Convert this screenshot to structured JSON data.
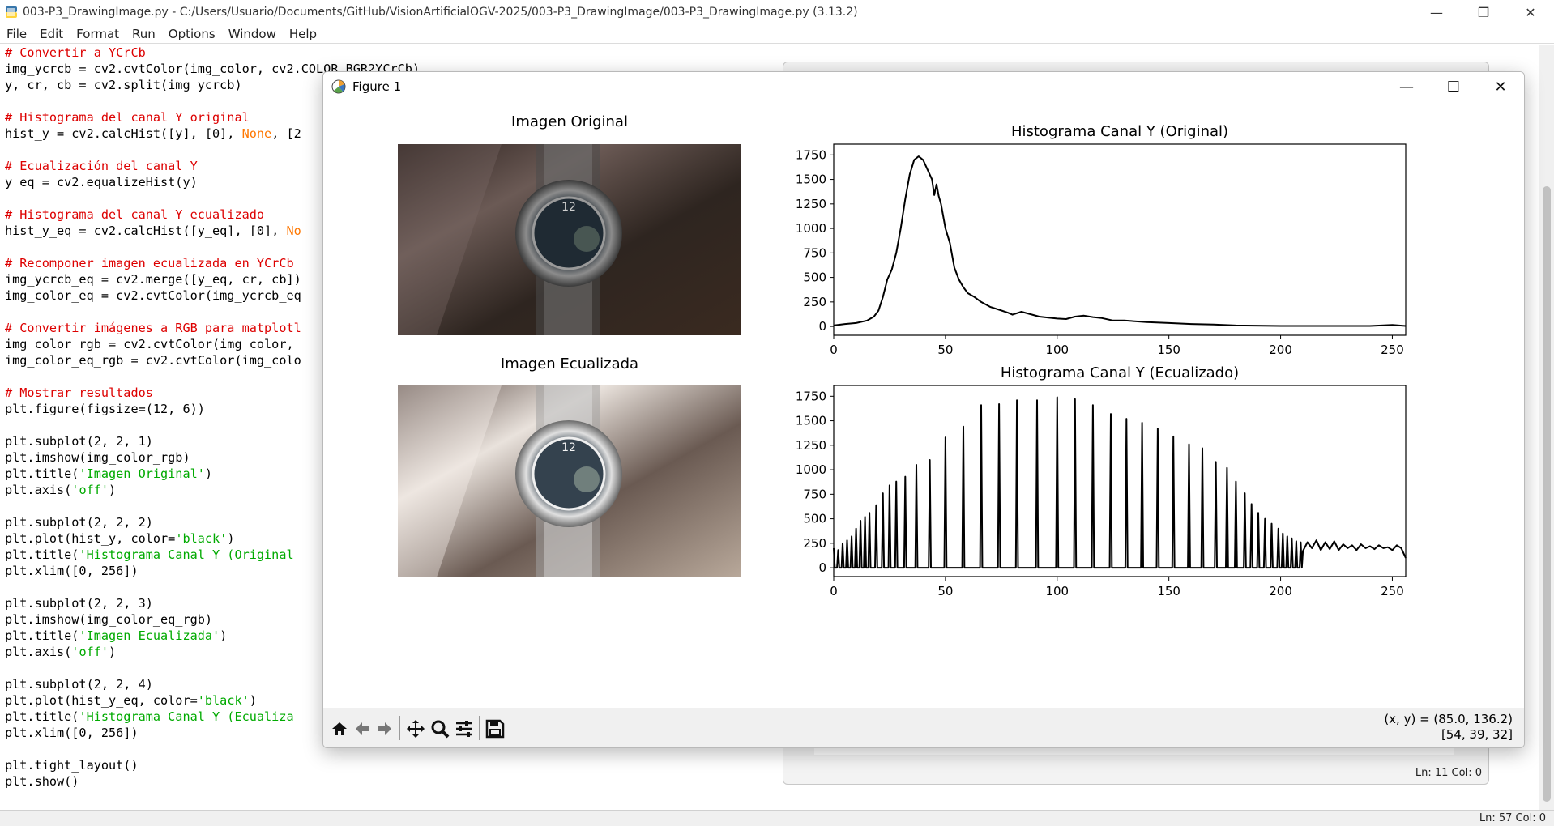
{
  "idle": {
    "title": "003-P3_DrawingImage.py - C:/Users/Usuario/Documents/GitHub/VisionArtificialOGV-2025/003-P3_DrawingImage/003-P3_DrawingImage.py (3.13.2)",
    "menu": [
      {
        "first": "F",
        "rest": "ile"
      },
      {
        "first": "E",
        "rest": "dit"
      },
      {
        "first": "F",
        "rest": "o",
        "pre": "F",
        "u": "o",
        "post": "rmat"
      },
      {
        "first": "R",
        "rest": "un"
      },
      {
        "first": "O",
        "rest": "ptions"
      },
      {
        "first": "W",
        "rest": "indow"
      },
      {
        "first": "H",
        "rest": "elp"
      }
    ],
    "menu_labels": [
      "File",
      "Edit",
      "Format",
      "Run",
      "Options",
      "Window",
      "Help"
    ],
    "status": "Ln: 57   Col: 0",
    "window_controls": [
      "—",
      "❐",
      "✕"
    ]
  },
  "code_lines": [
    [
      {
        "t": "c",
        "v": "# Convertir a YCrCb"
      }
    ],
    [
      {
        "t": "n",
        "v": "img_ycrcb = cv2.cvtColor(img_color, cv2.COLOR_BGR2YCrCb)"
      }
    ],
    [
      {
        "t": "n",
        "v": "y, cr, cb = cv2.split(img_ycrcb)"
      }
    ],
    [
      {
        "t": "n",
        "v": ""
      }
    ],
    [
      {
        "t": "c",
        "v": "# Histograma del canal Y original"
      }
    ],
    [
      {
        "t": "n",
        "v": "hist_y = cv2.calcHist([y], [0], "
      },
      {
        "t": "k",
        "v": "None"
      },
      {
        "t": "n",
        "v": ", [2"
      }
    ],
    [
      {
        "t": "n",
        "v": ""
      }
    ],
    [
      {
        "t": "c",
        "v": "# Ecualización del canal Y"
      }
    ],
    [
      {
        "t": "n",
        "v": "y_eq = cv2.equalizeHist(y)"
      }
    ],
    [
      {
        "t": "n",
        "v": ""
      }
    ],
    [
      {
        "t": "c",
        "v": "# Histograma del canal Y ecualizado"
      }
    ],
    [
      {
        "t": "n",
        "v": "hist_y_eq = cv2.calcHist([y_eq], [0], "
      },
      {
        "t": "k",
        "v": "No"
      }
    ],
    [
      {
        "t": "n",
        "v": ""
      }
    ],
    [
      {
        "t": "c",
        "v": "# Recomponer imagen ecualizada en YCrCb"
      }
    ],
    [
      {
        "t": "n",
        "v": "img_ycrcb_eq = cv2.merge([y_eq, cr, cb])"
      }
    ],
    [
      {
        "t": "n",
        "v": "img_color_eq = cv2.cvtColor(img_ycrcb_eq"
      }
    ],
    [
      {
        "t": "n",
        "v": ""
      }
    ],
    [
      {
        "t": "c",
        "v": "# Convertir imágenes a RGB para matplotl"
      }
    ],
    [
      {
        "t": "n",
        "v": "img_color_rgb = cv2.cvtColor(img_color,"
      }
    ],
    [
      {
        "t": "n",
        "v": "img_color_eq_rgb = cv2.cvtColor(img_colo"
      }
    ],
    [
      {
        "t": "n",
        "v": ""
      }
    ],
    [
      {
        "t": "c",
        "v": "# Mostrar resultados"
      }
    ],
    [
      {
        "t": "n",
        "v": "plt.figure(figsize=(12, 6))"
      }
    ],
    [
      {
        "t": "n",
        "v": ""
      }
    ],
    [
      {
        "t": "n",
        "v": "plt.subplot(2, 2, 1)"
      }
    ],
    [
      {
        "t": "n",
        "v": "plt.imshow(img_color_rgb)"
      }
    ],
    [
      {
        "t": "n",
        "v": "plt.title("
      },
      {
        "t": "s",
        "v": "'Imagen Original'"
      },
      {
        "t": "n",
        "v": ")"
      }
    ],
    [
      {
        "t": "n",
        "v": "plt.axis("
      },
      {
        "t": "s",
        "v": "'off'"
      },
      {
        "t": "n",
        "v": ")"
      }
    ],
    [
      {
        "t": "n",
        "v": ""
      }
    ],
    [
      {
        "t": "n",
        "v": "plt.subplot(2, 2, 2)"
      }
    ],
    [
      {
        "t": "n",
        "v": "plt.plot(hist_y, color="
      },
      {
        "t": "s",
        "v": "'black'"
      },
      {
        "t": "n",
        "v": ")"
      }
    ],
    [
      {
        "t": "n",
        "v": "plt.title("
      },
      {
        "t": "s",
        "v": "'Histograma Canal Y (Original"
      }
    ],
    [
      {
        "t": "n",
        "v": "plt.xlim([0, 256])"
      }
    ],
    [
      {
        "t": "n",
        "v": ""
      }
    ],
    [
      {
        "t": "n",
        "v": "plt.subplot(2, 2, 3)"
      }
    ],
    [
      {
        "t": "n",
        "v": "plt.imshow(img_color_eq_rgb)"
      }
    ],
    [
      {
        "t": "n",
        "v": "plt.title("
      },
      {
        "t": "s",
        "v": "'Imagen Ecualizada'"
      },
      {
        "t": "n",
        "v": ")"
      }
    ],
    [
      {
        "t": "n",
        "v": "plt.axis("
      },
      {
        "t": "s",
        "v": "'off'"
      },
      {
        "t": "n",
        "v": ")"
      }
    ],
    [
      {
        "t": "n",
        "v": ""
      }
    ],
    [
      {
        "t": "n",
        "v": "plt.subplot(2, 2, 4)"
      }
    ],
    [
      {
        "t": "n",
        "v": "plt.plot(hist_y_eq, color="
      },
      {
        "t": "s",
        "v": "'black'"
      },
      {
        "t": "n",
        "v": ")"
      }
    ],
    [
      {
        "t": "n",
        "v": "plt.title("
      },
      {
        "t": "s",
        "v": "'Histograma Canal Y (Ecualiza"
      }
    ],
    [
      {
        "t": "n",
        "v": "plt.xlim([0, 256])"
      }
    ],
    [
      {
        "t": "n",
        "v": ""
      }
    ],
    [
      {
        "t": "n",
        "v": "plt.tight_layout()"
      }
    ],
    [
      {
        "t": "n",
        "v": "plt.show()"
      }
    ]
  ],
  "code_colors": {
    "comment": "#dd0000",
    "string": "#00aa00",
    "keyword": "#ff7700"
  },
  "shell": {
    "status": "Ln: 11   Col: 0"
  },
  "figure": {
    "title": "Figure 1",
    "window_controls": [
      "—",
      "☐",
      "✕"
    ],
    "coords_line1": "(x, y) = (85.0, 136.2)",
    "coords_line2": "[54, 39, 32]",
    "toolbar": [
      "home-icon",
      "back-icon",
      "forward-icon",
      "pan-icon",
      "zoom-icon",
      "configure-icon",
      "save-icon"
    ]
  },
  "chart_data": [
    {
      "type": "image",
      "title": "Imagen Original"
    },
    {
      "type": "line",
      "title": "Histograma Canal Y (Original)",
      "xlim": [
        0,
        256
      ],
      "ylim": [
        -90,
        1860
      ],
      "xticks": [
        0,
        50,
        100,
        150,
        200,
        250
      ],
      "yticks": [
        0,
        250,
        500,
        750,
        1000,
        1250,
        1500,
        1750
      ],
      "color": "#000000",
      "points": [
        [
          0,
          10
        ],
        [
          5,
          25
        ],
        [
          10,
          35
        ],
        [
          15,
          60
        ],
        [
          18,
          100
        ],
        [
          20,
          160
        ],
        [
          22,
          300
        ],
        [
          24,
          480
        ],
        [
          26,
          580
        ],
        [
          28,
          750
        ],
        [
          30,
          1000
        ],
        [
          32,
          1300
        ],
        [
          34,
          1550
        ],
        [
          36,
          1700
        ],
        [
          38,
          1735
        ],
        [
          40,
          1700
        ],
        [
          42,
          1600
        ],
        [
          44,
          1500
        ],
        [
          45,
          1340
        ],
        [
          46,
          1450
        ],
        [
          47,
          1330
        ],
        [
          48,
          1250
        ],
        [
          50,
          1000
        ],
        [
          52,
          850
        ],
        [
          54,
          600
        ],
        [
          56,
          480
        ],
        [
          58,
          400
        ],
        [
          60,
          340
        ],
        [
          63,
          300
        ],
        [
          66,
          250
        ],
        [
          70,
          200
        ],
        [
          74,
          170
        ],
        [
          78,
          140
        ],
        [
          80,
          120
        ],
        [
          84,
          150
        ],
        [
          88,
          125
        ],
        [
          92,
          100
        ],
        [
          96,
          90
        ],
        [
          100,
          80
        ],
        [
          104,
          75
        ],
        [
          108,
          100
        ],
        [
          112,
          110
        ],
        [
          116,
          95
        ],
        [
          120,
          85
        ],
        [
          125,
          60
        ],
        [
          130,
          60
        ],
        [
          140,
          45
        ],
        [
          150,
          35
        ],
        [
          160,
          25
        ],
        [
          170,
          20
        ],
        [
          180,
          10
        ],
        [
          200,
          5
        ],
        [
          220,
          5
        ],
        [
          240,
          5
        ],
        [
          250,
          15
        ],
        [
          256,
          5
        ]
      ]
    },
    {
      "type": "image",
      "title": "Imagen Ecualizada"
    },
    {
      "type": "line",
      "title": "Histograma Canal Y (Ecualizado)",
      "xlim": [
        0,
        256
      ],
      "ylim": [
        -90,
        1860
      ],
      "xticks": [
        0,
        50,
        100,
        150,
        200,
        250
      ],
      "yticks": [
        0,
        250,
        500,
        750,
        1000,
        1250,
        1500,
        1750
      ],
      "color": "#000000",
      "spikes": [
        [
          0,
          200
        ],
        [
          2,
          180
        ],
        [
          4,
          250
        ],
        [
          6,
          280
        ],
        [
          8,
          320
        ],
        [
          10,
          400
        ],
        [
          12,
          480
        ],
        [
          14,
          520
        ],
        [
          16,
          560
        ],
        [
          19,
          640
        ],
        [
          22,
          760
        ],
        [
          25,
          840
        ],
        [
          28,
          880
        ],
        [
          32,
          930
        ],
        [
          37,
          1050
        ],
        [
          43,
          1100
        ],
        [
          50,
          1330
        ],
        [
          58,
          1440
        ],
        [
          66,
          1660
        ],
        [
          74,
          1670
        ],
        [
          82,
          1710
        ],
        [
          91,
          1710
        ],
        [
          100,
          1740
        ],
        [
          108,
          1720
        ],
        [
          116,
          1660
        ],
        [
          124,
          1570
        ],
        [
          131,
          1520
        ],
        [
          138,
          1480
        ],
        [
          145,
          1420
        ],
        [
          152,
          1340
        ],
        [
          159,
          1260
        ],
        [
          165,
          1220
        ],
        [
          171,
          1080
        ],
        [
          176,
          1020
        ],
        [
          180,
          880
        ],
        [
          184,
          760
        ],
        [
          187,
          650
        ],
        [
          190,
          560
        ],
        [
          193,
          500
        ],
        [
          196,
          450
        ],
        [
          199,
          400
        ],
        [
          201,
          350
        ],
        [
          203,
          320
        ],
        [
          205,
          300
        ],
        [
          207,
          270
        ],
        [
          209,
          260
        ]
      ],
      "tail": [
        [
          210,
          170
        ],
        [
          212,
          260
        ],
        [
          214,
          200
        ],
        [
          216,
          280
        ],
        [
          218,
          180
        ],
        [
          220,
          260
        ],
        [
          222,
          190
        ],
        [
          224,
          270
        ],
        [
          226,
          180
        ],
        [
          228,
          240
        ],
        [
          230,
          200
        ],
        [
          232,
          230
        ],
        [
          234,
          180
        ],
        [
          236,
          240
        ],
        [
          238,
          200
        ],
        [
          240,
          220
        ],
        [
          242,
          190
        ],
        [
          244,
          230
        ],
        [
          246,
          200
        ],
        [
          248,
          210
        ],
        [
          250,
          180
        ],
        [
          252,
          230
        ],
        [
          254,
          200
        ],
        [
          256,
          100
        ]
      ]
    }
  ]
}
